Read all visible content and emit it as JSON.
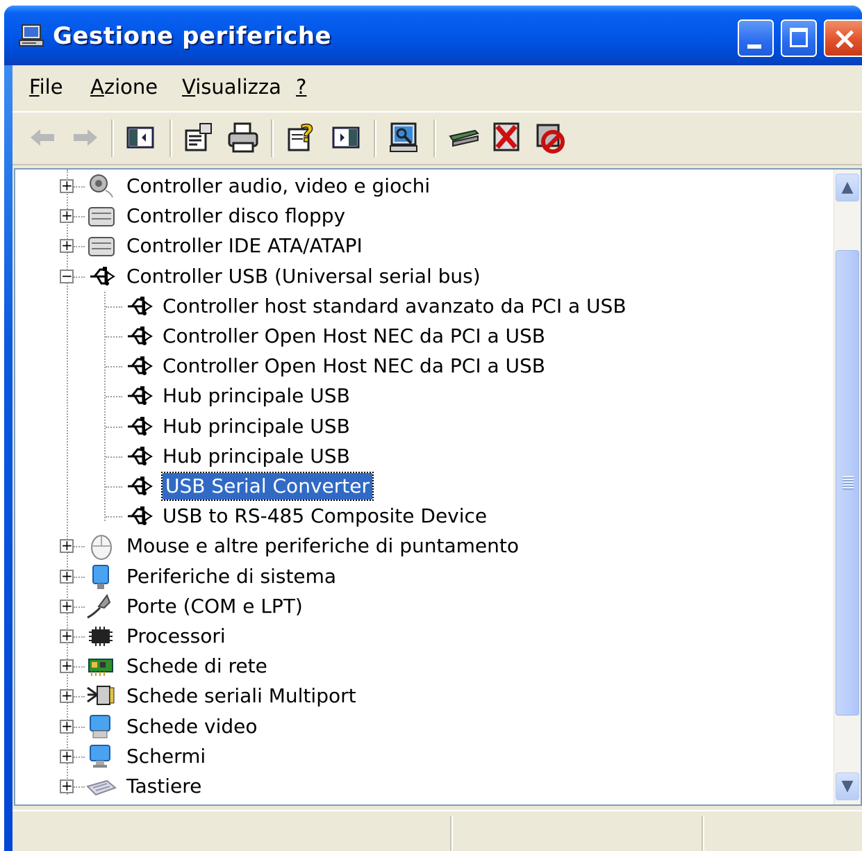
{
  "window": {
    "title": "Gestione periferiche",
    "title_icon": "computer-icon",
    "controls": [
      "minimize-icon",
      "maximize-icon",
      "close-icon"
    ]
  },
  "menu": {
    "items": [
      {
        "label": "File",
        "accel": "F"
      },
      {
        "label": "Azione",
        "accel": "A"
      },
      {
        "label": "Visualizza",
        "accel": "V"
      },
      {
        "label": "?",
        "accel": "?"
      }
    ]
  },
  "toolbar": {
    "buttons": [
      "back-icon",
      "forward-icon",
      "show-hide-tree-icon",
      "properties-icon",
      "print-icon",
      "help-icon",
      "show-hide-pane-icon",
      "scan-hardware-icon",
      "update-driver-icon",
      "uninstall-icon",
      "disable-icon"
    ]
  },
  "tree": {
    "items": [
      {
        "label": "Controller audio, video e giochi",
        "level": 0,
        "expander": "+",
        "icon": "sound-icon"
      },
      {
        "label": "Controller disco floppy",
        "level": 0,
        "expander": "+",
        "icon": "floppy-controller-icon"
      },
      {
        "label": "Controller IDE ATA/ATAPI",
        "level": 0,
        "expander": "+",
        "icon": "ide-controller-icon"
      },
      {
        "label": "Controller USB (Universal serial bus)",
        "level": 0,
        "expander": "−",
        "icon": "usb-icon"
      },
      {
        "label": "Controller host standard avanzato da PCI a USB",
        "level": 1,
        "icon": "usb-icon"
      },
      {
        "label": "Controller Open Host NEC da PCI a USB",
        "level": 1,
        "icon": "usb-icon"
      },
      {
        "label": "Controller Open Host NEC da PCI a USB",
        "level": 1,
        "icon": "usb-icon"
      },
      {
        "label": "Hub principale USB",
        "level": 1,
        "icon": "usb-icon"
      },
      {
        "label": "Hub principale USB",
        "level": 1,
        "icon": "usb-icon"
      },
      {
        "label": "Hub principale USB",
        "level": 1,
        "icon": "usb-icon"
      },
      {
        "label": "USB Serial Converter",
        "level": 1,
        "icon": "usb-icon",
        "selected": true
      },
      {
        "label": "USB to RS-485 Composite Device",
        "level": 1,
        "icon": "usb-icon"
      },
      {
        "label": "Mouse e altre periferiche di puntamento",
        "level": 0,
        "expander": "+",
        "icon": "mouse-icon"
      },
      {
        "label": "Periferiche di sistema",
        "level": 0,
        "expander": "+",
        "icon": "system-device-icon"
      },
      {
        "label": "Porte (COM e LPT)",
        "level": 0,
        "expander": "+",
        "icon": "port-icon"
      },
      {
        "label": "Processori",
        "level": 0,
        "expander": "+",
        "icon": "processor-icon"
      },
      {
        "label": "Schede di rete",
        "level": 0,
        "expander": "+",
        "icon": "network-card-icon"
      },
      {
        "label": "Schede seriali Multiport",
        "level": 0,
        "expander": "+",
        "icon": "multiport-serial-icon"
      },
      {
        "label": "Schede video",
        "level": 0,
        "expander": "+",
        "icon": "display-adapter-icon"
      },
      {
        "label": "Schermi",
        "level": 0,
        "expander": "+",
        "icon": "monitor-icon"
      },
      {
        "label": "Tastiere",
        "level": 0,
        "expander": "+",
        "icon": "keyboard-icon"
      }
    ]
  },
  "colors": {
    "selection": "#316ac5",
    "titlebar": "#0055e6",
    "chrome": "#ece9d8"
  }
}
